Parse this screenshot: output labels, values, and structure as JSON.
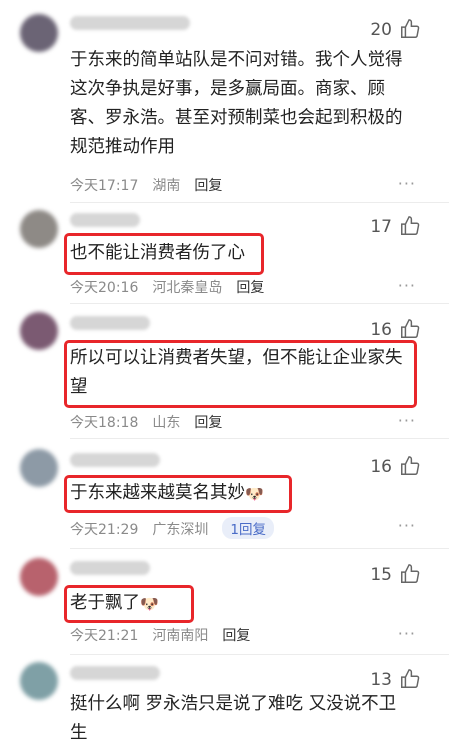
{
  "comments": [
    {
      "likes": "20",
      "text": "于东来的简单站队是不问对错。我个人觉得这次争执是好事，是多赢局面。商家、顾客、罗永浩。甚至对预制菜也会起到积极的规范推动作用",
      "time": "今天17:17",
      "location": "湖南",
      "reply_label": "回复",
      "avatar_color": "#6b6475"
    },
    {
      "likes": "17",
      "text": "也不能让消费者伤了心",
      "time": "今天20:16",
      "location": "河北秦皇岛",
      "reply_label": "回复",
      "avatar_color": "#8e8a86"
    },
    {
      "likes": "16",
      "text": "所以可以让消费者失望，但不能让企业家失望",
      "time": "今天18:18",
      "location": "山东",
      "reply_label": "回复",
      "avatar_color": "#7b5a72"
    },
    {
      "likes": "16",
      "text": "于东来越来越莫名其妙",
      "emoji": "🐶",
      "time": "今天21:29",
      "location": "广东深圳",
      "reply_label": "1回复",
      "avatar_color": "#8d9aa6"
    },
    {
      "likes": "15",
      "text": "老于飘了",
      "emoji": "🐶",
      "time": "今天21:21",
      "location": "河南南阳",
      "reply_label": "回复",
      "avatar_color": "#b8626d"
    },
    {
      "likes": "13",
      "text": "挺什么啊 罗永浩只是说了难吃 又没说不卫生",
      "avatar_color": "#7fa0a6"
    }
  ],
  "more_glyph": "···",
  "highlight_color": "#e8262a"
}
